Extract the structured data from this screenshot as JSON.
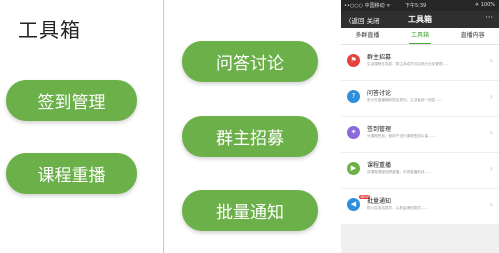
{
  "left": {
    "title": "工具箱",
    "buttons": [
      "签到管理",
      "课程重播"
    ]
  },
  "middle": {
    "buttons": [
      "问答讨论",
      "群主招募",
      "批量通知"
    ]
  },
  "phone": {
    "status": {
      "carrier": "••○○○ 中国移动 ᯤ",
      "time": "下午5:39",
      "battery": "✈ 100%"
    },
    "nav": {
      "back": "〈返回  关闭",
      "title": "工具箱",
      "more": "···"
    },
    "tabs": [
      "多群直播",
      "工具箱",
      "直播内容"
    ],
    "items": [
      {
        "name": "群主招募",
        "desc": "生活课程在发起，群主添成员可实现分社化管理……",
        "color": "#e64340",
        "icon": "flag-icon"
      },
      {
        "name": "问答讨论",
        "desc": "听众在直播期间提出提问，主讲者统一回答……",
        "color": "#2f8fdd",
        "icon": "qa-icon"
      },
      {
        "name": "签到管理",
        "desc": "分课程签到，使用户进行课程签到以保……",
        "color": "#8a6bd9",
        "icon": "checkin-icon"
      },
      {
        "name": "课程重播",
        "desc": "将课程课程回顾重播，可再直播前线……",
        "color": "#6cb04a",
        "icon": "replay-icon"
      },
      {
        "name": "批量通知",
        "desc": "群公告发给群员，以批量通知群员……",
        "color": "#2f8fdd",
        "icon": "megaphone-icon",
        "badge": "NEW"
      }
    ]
  }
}
